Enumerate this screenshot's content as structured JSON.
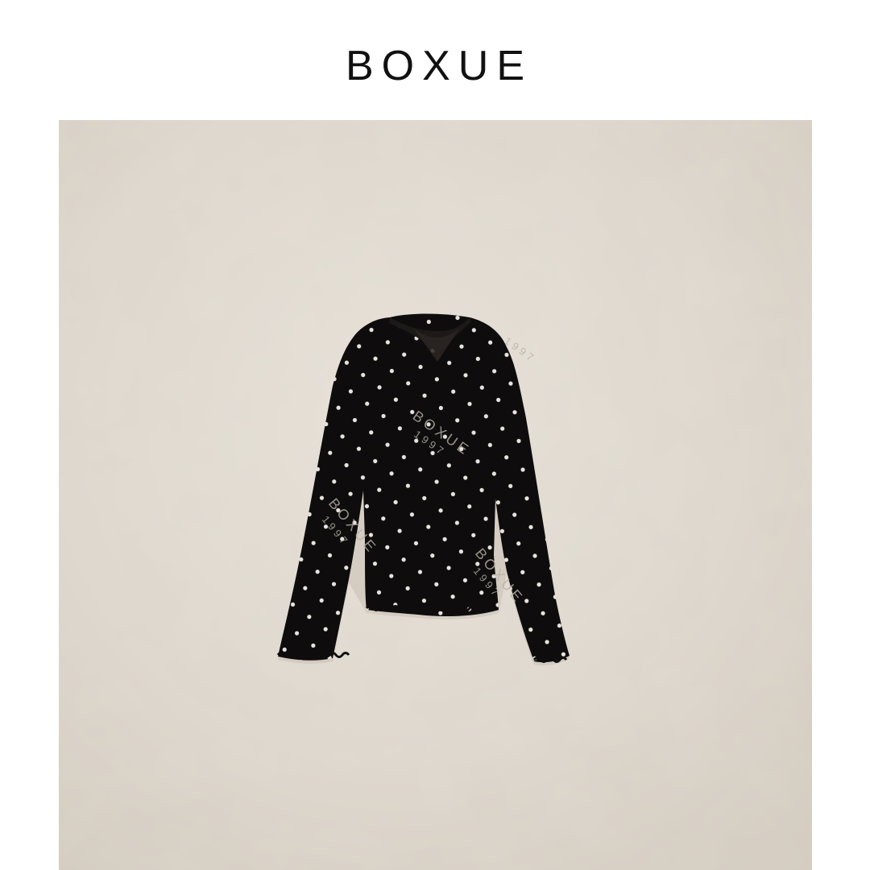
{
  "header": {
    "brand": "BOXUE"
  },
  "product_image": {
    "icon": "polka-dot-long-sleeve-top",
    "background_color": "#dcd5cb",
    "garment_color": "#0e0c0c",
    "dot_color": "#e8e4df",
    "watermark_brand": "BOXUE",
    "watermark_year": "1997"
  }
}
